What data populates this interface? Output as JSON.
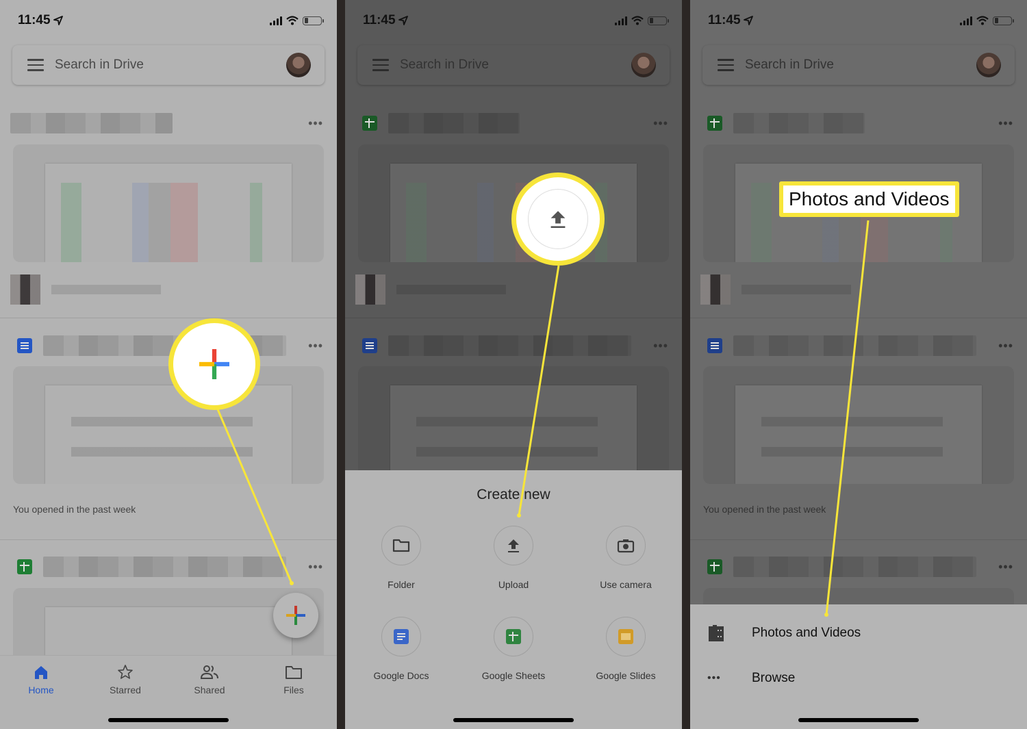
{
  "status_bar": {
    "time": "11:45",
    "location_icon": "location-arrow-icon",
    "signal_icon": "cellular-signal-icon",
    "wifi_icon": "wifi-icon",
    "battery_icon": "battery-low-icon",
    "battery_level": 0.25
  },
  "search": {
    "placeholder": "Search in Drive",
    "menu_icon": "hamburger-menu-icon"
  },
  "files": [
    {
      "type": "sheets",
      "name": "(blurred file name)",
      "more_icon": "more-horizontal-icon"
    },
    {
      "type": "docs",
      "name": "(blurred file name)",
      "more_icon": "more-horizontal-icon"
    },
    {
      "type": "sheets",
      "name": "(blurred file name)",
      "more_icon": "more-horizontal-icon"
    }
  ],
  "section_label": "You opened in the past week",
  "bottom_nav": {
    "items": [
      {
        "label": "Home",
        "icon": "home-icon",
        "active": true
      },
      {
        "label": "Starred",
        "icon": "star-icon",
        "active": false
      },
      {
        "label": "Shared",
        "icon": "shared-people-icon",
        "active": false
      },
      {
        "label": "Files",
        "icon": "folder-icon",
        "active": false
      }
    ]
  },
  "fab": {
    "icon": "plus-icon",
    "label": "New"
  },
  "create_new": {
    "title": "Create new",
    "items": [
      {
        "label": "Folder",
        "icon": "folder-icon"
      },
      {
        "label": "Upload",
        "icon": "upload-icon"
      },
      {
        "label": "Use camera",
        "icon": "camera-icon"
      },
      {
        "label": "Google Docs",
        "icon": "google-docs-icon"
      },
      {
        "label": "Google Sheets",
        "icon": "google-sheets-icon"
      },
      {
        "label": "Google Slides",
        "icon": "google-slides-icon"
      }
    ]
  },
  "upload_sheet": {
    "items": [
      {
        "label": "Photos and Videos",
        "icon": "film-icon"
      },
      {
        "label": "Browse",
        "icon": "more-horizontal-icon"
      }
    ]
  },
  "callouts": {
    "step1": "plus-icon",
    "step2": "upload-icon",
    "step3": "Photos and Videos"
  },
  "colors": {
    "highlight": "#f7e53a",
    "active_blue": "#2456c4",
    "sheets_green": "#1e7e34",
    "slides_yellow": "#e2a82a",
    "google_red": "#ea4335",
    "google_blue": "#4285f4",
    "google_green": "#34a853",
    "google_yellow": "#fbbc04"
  }
}
